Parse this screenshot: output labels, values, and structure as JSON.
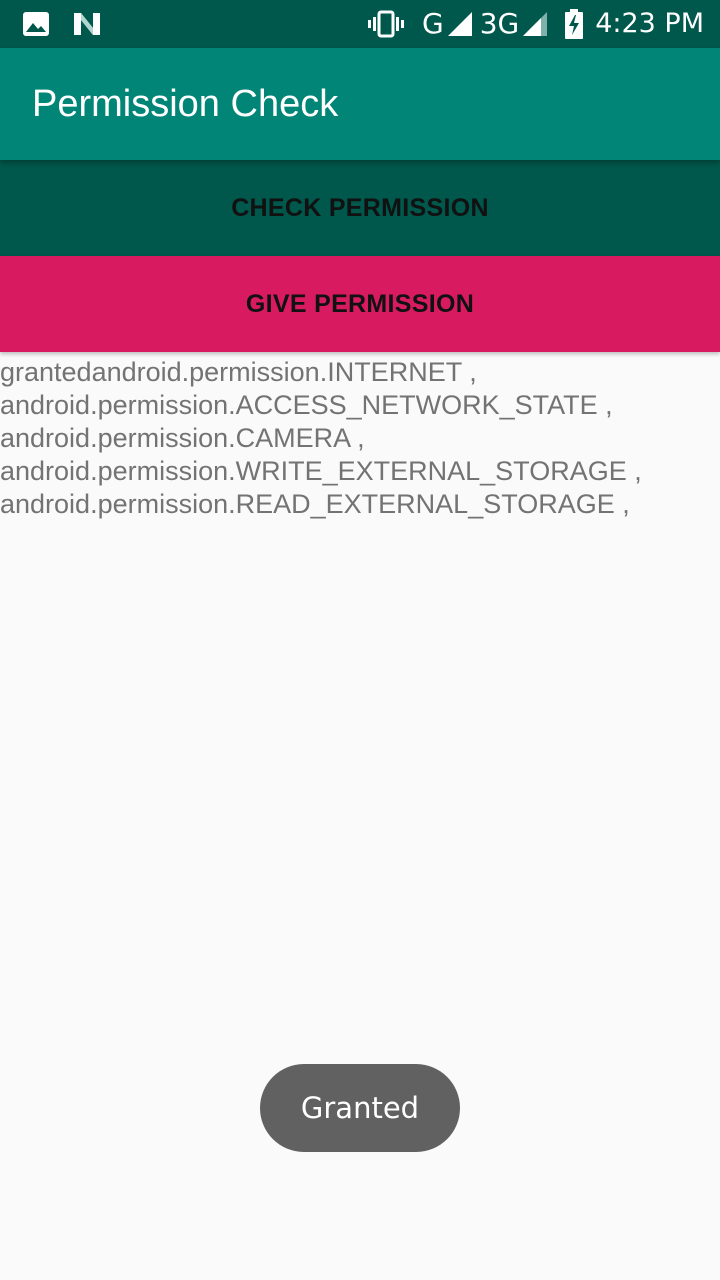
{
  "status_bar": {
    "left_icons": [
      "image-icon",
      "n-notification-icon"
    ],
    "right_icons": [
      "vibrate-icon",
      "signal-g-icon",
      "signal-3g-icon",
      "battery-charging-icon"
    ],
    "network_g": "G",
    "network_3g": "3G",
    "time": "4:23 PM"
  },
  "app_bar": {
    "title": "Permission Check"
  },
  "buttons": {
    "check_label": "CHECK PERMISSION",
    "give_label": "GIVE PERMISSION"
  },
  "permissions": {
    "lines": [
      "grantedandroid.permission.INTERNET ,",
      "android.permission.ACCESS_NETWORK_STATE ,",
      "android.permission.CAMERA ,",
      "android.permission.WRITE_EXTERNAL_STORAGE ,",
      "android.permission.READ_EXTERNAL_STORAGE ,"
    ]
  },
  "toast": {
    "text": "Granted"
  },
  "colors": {
    "status_bar": "#00574b",
    "app_bar": "#008577",
    "check_button": "#00574b",
    "give_button": "#d81b60",
    "background": "#fafafa",
    "toast": "#616161",
    "list_text": "#737373"
  }
}
